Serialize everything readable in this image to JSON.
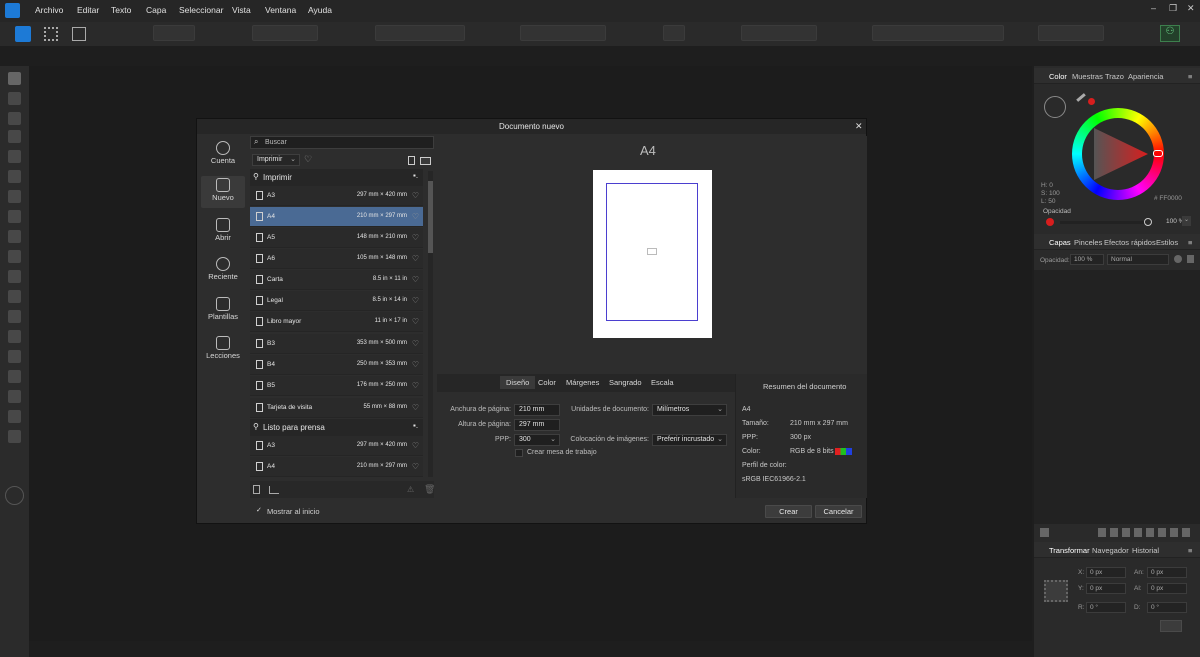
{
  "menu": [
    "Archivo",
    "Editar",
    "Texto",
    "Capa",
    "Seleccionar",
    "Vista",
    "Ventana",
    "Ayuda"
  ],
  "colors": {
    "accent": "#4a6a94",
    "wheel_red": "#d81e1e",
    "page_outline": "#4b3fcf"
  },
  "color_panel": {
    "tabs": [
      "Color",
      "Muestras",
      "Trazo",
      "Apariencia"
    ],
    "hsl": [
      "H: 0",
      "S: 100",
      "L: 50"
    ],
    "hex": "FF0000",
    "opacity_label": "Opacidad",
    "opacity_value": "100 %"
  },
  "layers_panel": {
    "tabs": [
      "Capas",
      "Pinceles",
      "Efectos rápidos",
      "Estilos"
    ],
    "opacity_label": "Opacidad:",
    "opacity_value": "100 %",
    "blend_mode": "Normal"
  },
  "transform_panel": {
    "tabs": [
      "Transformar",
      "Navegador",
      "Historial"
    ],
    "x_label": "X:",
    "x_value": "0 px",
    "y_label": "Y:",
    "y_value": "0 px",
    "w_label": "An:",
    "w_value": "0 px",
    "h_label": "Al:",
    "h_value": "0 px",
    "r_label": "R:",
    "r_value": "0 °",
    "s_label": "D:",
    "s_value": "0 °"
  },
  "dialog": {
    "title": "Documento nuevo",
    "nav": [
      "Cuenta",
      "Nuevo",
      "Abrir",
      "Reciente",
      "Plantillas",
      "Lecciones"
    ],
    "search_placeholder": "Buscar",
    "category": "Imprimir",
    "sections": [
      "Imprimir",
      "Listo para prensa"
    ],
    "presets": [
      {
        "name": "A3",
        "size": "297 mm × 420 mm"
      },
      {
        "name": "A4",
        "size": "210 mm × 297 mm"
      },
      {
        "name": "A5",
        "size": "148 mm × 210 mm"
      },
      {
        "name": "A6",
        "size": "105 mm × 148 mm"
      },
      {
        "name": "Carta",
        "size": "8.5 in × 11 in"
      },
      {
        "name": "Legal",
        "size": "8.5 in × 14 in"
      },
      {
        "name": "Libro mayor",
        "size": "11 in × 17 in"
      },
      {
        "name": "B3",
        "size": "353 mm × 500 mm"
      },
      {
        "name": "B4",
        "size": "250 mm × 353 mm"
      },
      {
        "name": "B5",
        "size": "176 mm × 250 mm"
      },
      {
        "name": "Tarjeta de visita",
        "size": "55 mm × 88 mm"
      }
    ],
    "press_presets": [
      {
        "name": "A3",
        "size": "297 mm × 420 mm"
      },
      {
        "name": "A4",
        "size": "210 mm × 297 mm"
      }
    ],
    "preview_title": "A4",
    "tabs": [
      "Diseño",
      "Color",
      "Márgenes",
      "Sangrado",
      "Escala"
    ],
    "fields": {
      "width_label": "Anchura de página:",
      "width_value": "210 mm",
      "height_label": "Altura de página:",
      "height_value": "297 mm",
      "dpi_label": "PPP:",
      "dpi_value": "300",
      "artboard_label": "Crear mesa de trabajo",
      "units_label": "Unidades de documento:",
      "units_value": "Milímetros",
      "placement_label": "Colocación de imágenes:",
      "placement_value": "Preferir incrustado"
    },
    "summary": {
      "title": "Resumen del documento",
      "name": "A4",
      "size_label": "Tamaño:",
      "size_value": "210 mm  x  297 mm",
      "dpi_label": "PPP:",
      "dpi_value": "300 px",
      "color_label": "Color:",
      "color_value": "RGB de 8 bits",
      "profile_label": "Perfil de color:",
      "profile_value": "sRGB IEC61966-2.1"
    },
    "show_at_start": "Mostrar al inicio",
    "create": "Crear",
    "cancel": "Cancelar"
  }
}
